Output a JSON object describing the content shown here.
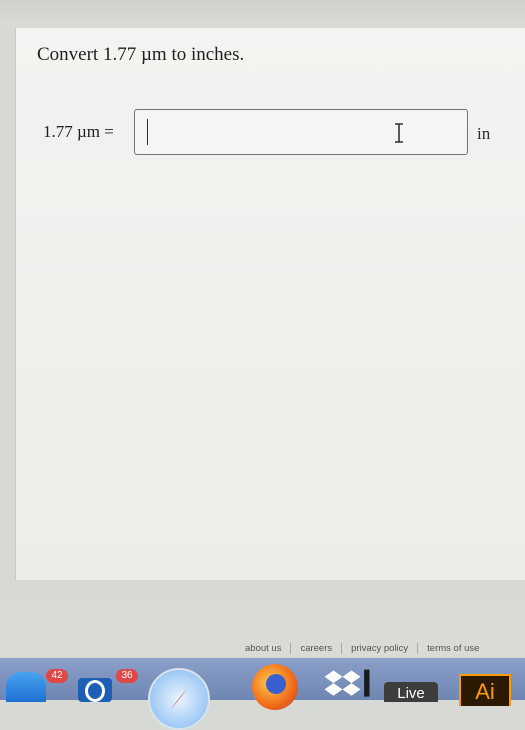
{
  "question": {
    "text": "Convert 1.77 µm to inches.",
    "equation_label": "1.77 µm =",
    "answer_value": "",
    "unit": "in"
  },
  "footer": {
    "links": [
      "about us",
      "careers",
      "privacy policy",
      "terms of use"
    ]
  },
  "dock": {
    "badges": {
      "mail": "42",
      "outlook": "36"
    },
    "live_label": "Live",
    "ai_label": "Ai"
  },
  "colors": {
    "card": "#f2f3f0",
    "input_border": "#747474",
    "badge": "#e04848"
  }
}
